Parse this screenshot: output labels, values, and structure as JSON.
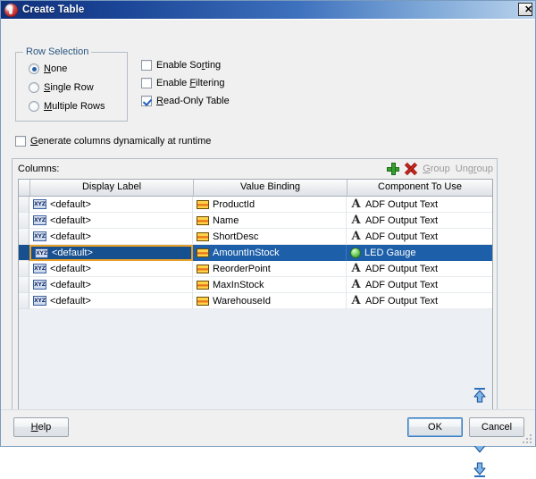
{
  "window": {
    "title": "Create Table",
    "app_icon": "oracle-jdeveloper-icon",
    "close_label": "✕"
  },
  "row_selection": {
    "group_title": "Row Selection",
    "options": [
      {
        "label": "None",
        "mnemonic": "N",
        "checked": true
      },
      {
        "label": "Single Row",
        "mnemonic": "S",
        "checked": false
      },
      {
        "label": "Multiple Rows",
        "mnemonic": "M",
        "checked": false
      }
    ]
  },
  "options": {
    "checkboxes": [
      {
        "label": "Enable Sorting",
        "mnemonic": "r",
        "checked": false
      },
      {
        "label": "Enable Filtering",
        "mnemonic": "F",
        "checked": false
      },
      {
        "label": "Read-Only Table",
        "mnemonic": "R",
        "checked": true
      }
    ],
    "generate_dynamic": {
      "label": "Generate columns dynamically at runtime",
      "mnemonic": "G",
      "checked": false
    }
  },
  "columns_panel": {
    "label": "Columns:",
    "toolbar": {
      "add_icon": "add-plus-icon",
      "delete_icon": "delete-x-icon",
      "group_label": "Group",
      "group_mnemonic": "G",
      "ungroup_label": "Ungroup",
      "ungroup_mnemonic": "r",
      "group_enabled": false,
      "ungroup_enabled": false
    },
    "table": {
      "headers": [
        "Display Label",
        "Value Binding",
        "Component To Use"
      ],
      "rows": [
        {
          "display_label": "<default>",
          "value_binding": "ProductId",
          "component": "ADF Output Text",
          "component_icon": "adf-output-text-icon",
          "selected": false
        },
        {
          "display_label": "<default>",
          "value_binding": "Name",
          "component": "ADF Output Text",
          "component_icon": "adf-output-text-icon",
          "selected": false
        },
        {
          "display_label": "<default>",
          "value_binding": "ShortDesc",
          "component": "ADF Output Text",
          "component_icon": "adf-output-text-icon",
          "selected": false
        },
        {
          "display_label": "<default>",
          "value_binding": "AmountInStock",
          "component": "LED Gauge",
          "component_icon": "led-gauge-icon",
          "selected": true
        },
        {
          "display_label": "<default>",
          "value_binding": "ReorderPoint",
          "component": "ADF Output Text",
          "component_icon": "adf-output-text-icon",
          "selected": false
        },
        {
          "display_label": "<default>",
          "value_binding": "MaxInStock",
          "component": "ADF Output Text",
          "component_icon": "adf-output-text-icon",
          "selected": false
        },
        {
          "display_label": "<default>",
          "value_binding": "WarehouseId",
          "component": "ADF Output Text",
          "component_icon": "adf-output-text-icon",
          "selected": false
        }
      ]
    },
    "move_buttons": [
      {
        "name": "move-to-top-button",
        "icon": "arrow-to-top-icon"
      },
      {
        "name": "move-up-button",
        "icon": "arrow-up-icon"
      },
      {
        "name": "move-down-button",
        "icon": "arrow-down-icon"
      },
      {
        "name": "move-to-bottom-button",
        "icon": "arrow-to-bottom-icon"
      }
    ]
  },
  "footer": {
    "help_label": "Help",
    "help_mnemonic": "H",
    "ok_label": "OK",
    "cancel_label": "Cancel"
  },
  "colors": {
    "title_bar_start": "#10307a",
    "title_bar_end": "#b9d2ec",
    "selection_blue": "#1d5fa8",
    "focus_cell_border": "#e8a22b",
    "group_title_text": "#2a5580",
    "disabled_link": "#9a9a9a",
    "add_icon_green": "#35a02e",
    "delete_icon_red": "#d02a1e",
    "led_green": "#4fb03c"
  }
}
